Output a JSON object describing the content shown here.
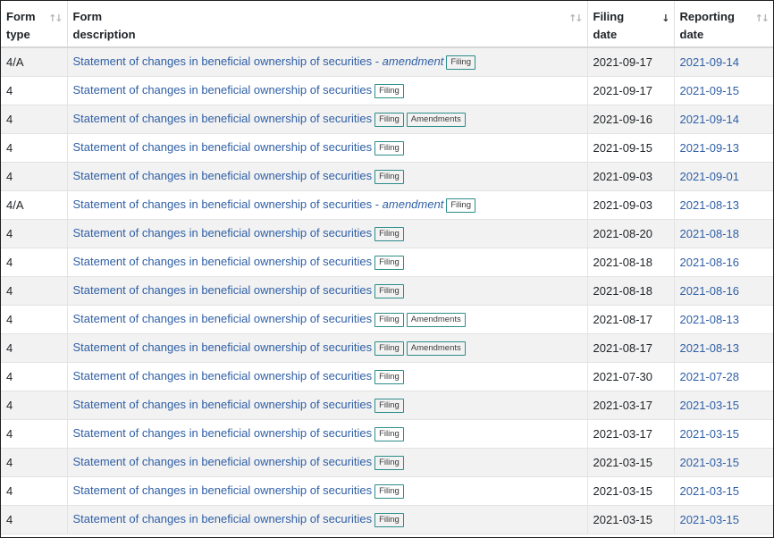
{
  "table": {
    "headers": {
      "form_type": [
        "Form",
        "type"
      ],
      "form_description": [
        "Form",
        "description"
      ],
      "filing_date": [
        "Filing",
        "date"
      ],
      "reporting_date": [
        "Reporting",
        "date"
      ]
    },
    "sort_icons": {
      "inactive": "↑↓",
      "active_desc": "↓"
    },
    "badges": {
      "filing": "Filing",
      "amendments": "Amendments"
    },
    "amendment_separator": " - ",
    "amendment_word": "amendment",
    "rows": [
      {
        "form_type": "4/A",
        "description": "Statement of changes in beneficial ownership of securities",
        "is_amendment": true,
        "has_amendments": false,
        "filing_date": "2021-09-17",
        "reporting_date": "2021-09-14"
      },
      {
        "form_type": "4",
        "description": "Statement of changes in beneficial ownership of securities",
        "is_amendment": false,
        "has_amendments": false,
        "filing_date": "2021-09-17",
        "reporting_date": "2021-09-15"
      },
      {
        "form_type": "4",
        "description": "Statement of changes in beneficial ownership of securities",
        "is_amendment": false,
        "has_amendments": true,
        "filing_date": "2021-09-16",
        "reporting_date": "2021-09-14"
      },
      {
        "form_type": "4",
        "description": "Statement of changes in beneficial ownership of securities",
        "is_amendment": false,
        "has_amendments": false,
        "filing_date": "2021-09-15",
        "reporting_date": "2021-09-13"
      },
      {
        "form_type": "4",
        "description": "Statement of changes in beneficial ownership of securities",
        "is_amendment": false,
        "has_amendments": false,
        "filing_date": "2021-09-03",
        "reporting_date": "2021-09-01"
      },
      {
        "form_type": "4/A",
        "description": "Statement of changes in beneficial ownership of securities",
        "is_amendment": true,
        "has_amendments": false,
        "filing_date": "2021-09-03",
        "reporting_date": "2021-08-13"
      },
      {
        "form_type": "4",
        "description": "Statement of changes in beneficial ownership of securities",
        "is_amendment": false,
        "has_amendments": false,
        "filing_date": "2021-08-20",
        "reporting_date": "2021-08-18"
      },
      {
        "form_type": "4",
        "description": "Statement of changes in beneficial ownership of securities",
        "is_amendment": false,
        "has_amendments": false,
        "filing_date": "2021-08-18",
        "reporting_date": "2021-08-16"
      },
      {
        "form_type": "4",
        "description": "Statement of changes in beneficial ownership of securities",
        "is_amendment": false,
        "has_amendments": false,
        "filing_date": "2021-08-18",
        "reporting_date": "2021-08-16"
      },
      {
        "form_type": "4",
        "description": "Statement of changes in beneficial ownership of securities",
        "is_amendment": false,
        "has_amendments": true,
        "filing_date": "2021-08-17",
        "reporting_date": "2021-08-13"
      },
      {
        "form_type": "4",
        "description": "Statement of changes in beneficial ownership of securities",
        "is_amendment": false,
        "has_amendments": true,
        "filing_date": "2021-08-17",
        "reporting_date": "2021-08-13"
      },
      {
        "form_type": "4",
        "description": "Statement of changes in beneficial ownership of securities",
        "is_amendment": false,
        "has_amendments": false,
        "filing_date": "2021-07-30",
        "reporting_date": "2021-07-28"
      },
      {
        "form_type": "4",
        "description": "Statement of changes in beneficial ownership of securities",
        "is_amendment": false,
        "has_amendments": false,
        "filing_date": "2021-03-17",
        "reporting_date": "2021-03-15"
      },
      {
        "form_type": "4",
        "description": "Statement of changes in beneficial ownership of securities",
        "is_amendment": false,
        "has_amendments": false,
        "filing_date": "2021-03-17",
        "reporting_date": "2021-03-15"
      },
      {
        "form_type": "4",
        "description": "Statement of changes in beneficial ownership of securities",
        "is_amendment": false,
        "has_amendments": false,
        "filing_date": "2021-03-15",
        "reporting_date": "2021-03-15"
      },
      {
        "form_type": "4",
        "description": "Statement of changes in beneficial ownership of securities",
        "is_amendment": false,
        "has_amendments": false,
        "filing_date": "2021-03-15",
        "reporting_date": "2021-03-15"
      },
      {
        "form_type": "4",
        "description": "Statement of changes in beneficial ownership of securities",
        "is_amendment": false,
        "has_amendments": false,
        "filing_date": "2021-03-15",
        "reporting_date": "2021-03-15"
      }
    ]
  },
  "colors": {
    "link": "#2f5fa6",
    "badge_border": "#2c8d89",
    "row_stripe": "#f2f2f2"
  }
}
